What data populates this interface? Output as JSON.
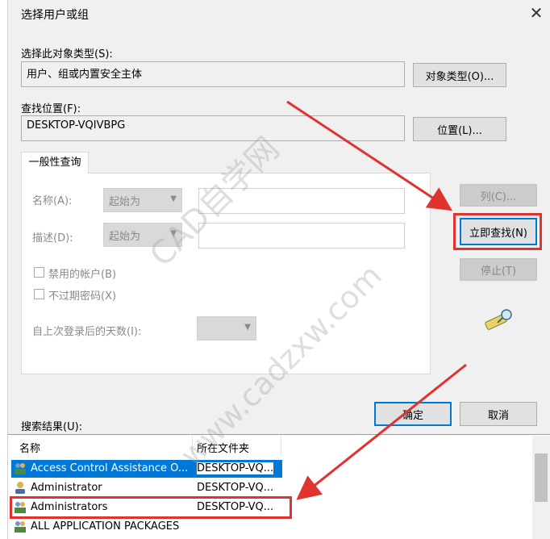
{
  "window": {
    "title": "选择用户或组",
    "close_glyph": "✕"
  },
  "object_type": {
    "label": "选择此对象类型(S):",
    "value": "用户、组或内置安全主体",
    "button": "对象类型(O)..."
  },
  "location": {
    "label": "查找位置(F):",
    "value": "DESKTOP-VQIVBPG",
    "button": "位置(L)..."
  },
  "query": {
    "tab": "一般性查询",
    "name_label": "名称(A):",
    "name_mode": "起始为",
    "desc_label": "描述(D):",
    "desc_mode": "起始为",
    "disabled_accounts": "禁用的帐户(B)",
    "no_expire_pwd": "不过期密码(X)",
    "days_label": "自上次登录后的天数(I):"
  },
  "actions": {
    "columns": "列(C)...",
    "find_now": "立即查找(N)",
    "stop": "停止(T)",
    "ok": "确定",
    "cancel": "取消"
  },
  "results": {
    "label": "搜索结果(U):",
    "columns": [
      "名称",
      "所在文件夹"
    ],
    "rows": [
      {
        "name": "Access Control Assistance O...",
        "folder": "DESKTOP-VQ...",
        "selected": true
      },
      {
        "name": "Administrator",
        "folder": "DESKTOP-VQ...",
        "selected": false
      },
      {
        "name": "Administrators",
        "folder": "DESKTOP-VQ...",
        "selected": false
      },
      {
        "name": "ALL APPLICATION PACKAGES",
        "folder": "",
        "selected": false
      }
    ]
  },
  "watermark": {
    "line1": "CAD自学网",
    "line2": "www.cadzxw.com"
  },
  "colors": {
    "accent": "#0078d7",
    "highlight": "#e0332f"
  }
}
